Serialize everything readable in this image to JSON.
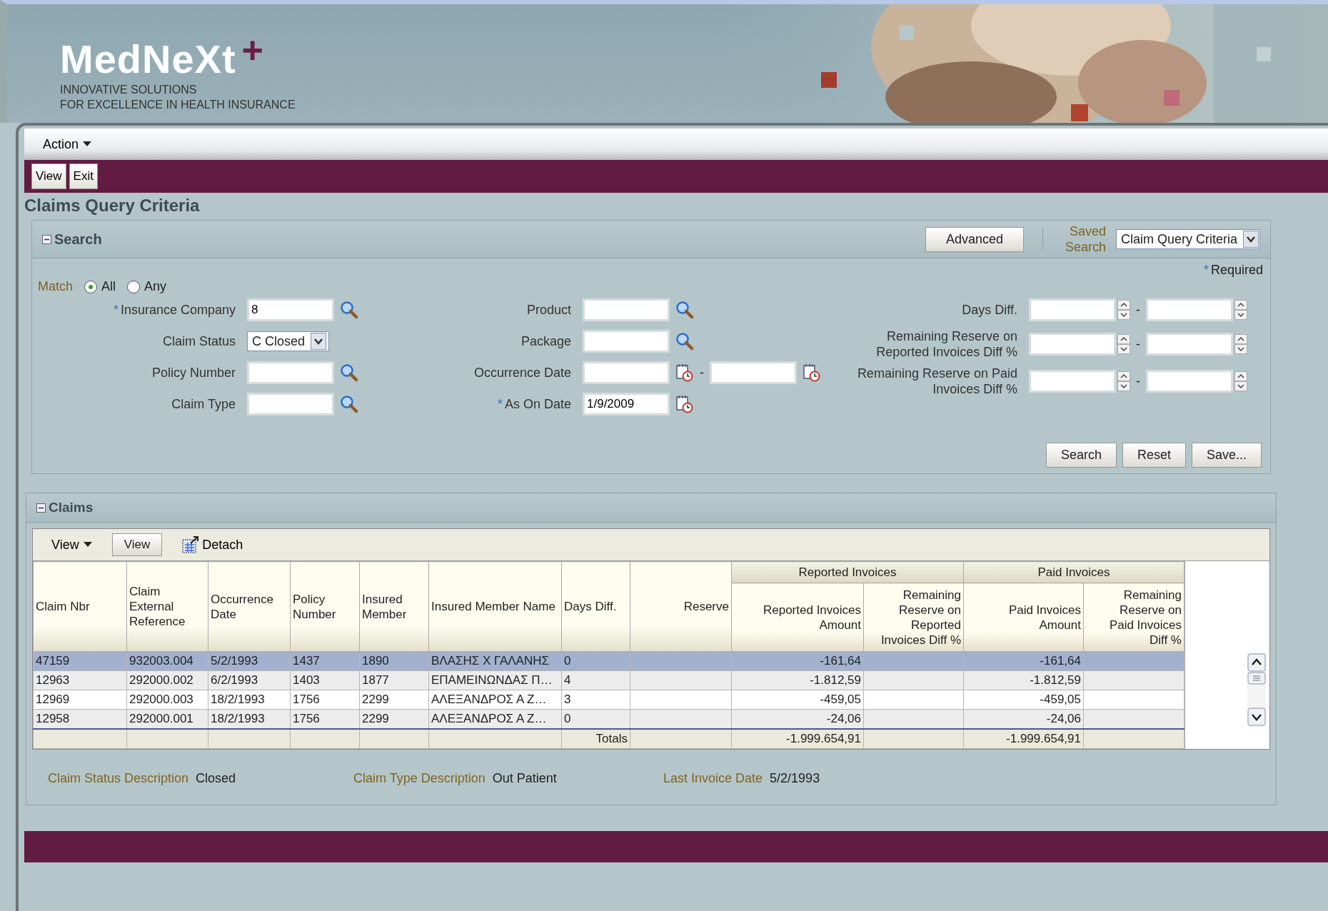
{
  "logo": {
    "name": "MedNeXt",
    "mark": "+",
    "tagline": [
      "INNOVATIVE SOLUTIONS",
      "FOR EXCELLENCE IN HEALTH INSURANCE"
    ]
  },
  "menu": {
    "label": "Action"
  },
  "toolbar": {
    "buttons": [
      "View",
      "Exit"
    ]
  },
  "page_title": "Claims Query Criteria",
  "search": {
    "title": "Search",
    "advanced": "Advanced",
    "saved_search_label": "Saved Search",
    "saved_search_value": "Claim Query Criteria",
    "required_mark": "*",
    "required_note": "Required",
    "match": {
      "label": "Match",
      "options": [
        {
          "label": "All",
          "selected": true
        },
        {
          "label": "Any",
          "selected": false
        }
      ]
    },
    "field_columns": [
      {
        "fields": [
          {
            "kind": "lookup",
            "label": "Insurance Company",
            "required": true,
            "value": "8"
          },
          {
            "kind": "select",
            "label": "Claim Status",
            "required": false,
            "value": "C Closed"
          },
          {
            "kind": "lookup",
            "label": "Policy Number",
            "required": false
          },
          {
            "kind": "lookup",
            "label": "Claim Type",
            "required": false
          }
        ]
      },
      {
        "fields": [
          {
            "kind": "lookup",
            "label": "Product",
            "required": false
          },
          {
            "kind": "lookup",
            "label": "Package",
            "required": false
          },
          {
            "kind": "date_range",
            "label": "Occurrence Date",
            "required": false,
            "separator": "-"
          },
          {
            "kind": "date",
            "label": "As On Date",
            "required": true,
            "value": "1/9/2009"
          }
        ]
      },
      {
        "fields": [
          {
            "kind": "spin_range",
            "label": "Days Diff.",
            "required": false,
            "separator": "-"
          },
          {
            "kind": "spin_range",
            "label": "Remaining Reserve on Reported Invoices Diff %",
            "required": false,
            "separator": "-"
          },
          {
            "kind": "spin_range",
            "label": "Remaining Reserve on Paid Invoices Diff %",
            "required": false,
            "separator": "-"
          }
        ]
      }
    ],
    "buttons": [
      "Search",
      "Reset",
      "Save..."
    ]
  },
  "claims": {
    "title": "Claims",
    "view_menu": "View",
    "view_button": "View",
    "detach": "Detach",
    "columns": [
      {
        "label": "Claim Nbr",
        "kind": "text"
      },
      {
        "label": "Claim External Reference",
        "kind": "text"
      },
      {
        "label": "Occurrence Date",
        "kind": "text"
      },
      {
        "label": "Policy Number",
        "kind": "text"
      },
      {
        "label": "Insured Member",
        "kind": "text"
      },
      {
        "label": "Insured Member Name",
        "kind": "text"
      },
      {
        "label": "Days Diff.",
        "kind": "text",
        "total": "Totals"
      },
      {
        "label": "Reserve",
        "kind": "number"
      },
      {
        "label": "Reported Invoices Amount",
        "kind": "number",
        "total": "-1.999.654,91",
        "group": "Reported Invoices"
      },
      {
        "label": "Remaining Reserve on Reported Invoices Diff %",
        "kind": "number",
        "in_group": true
      },
      {
        "label": "Paid Invoices Amount",
        "kind": "number",
        "total": "-1.999.654,91",
        "group": "Paid Invoices"
      },
      {
        "label": "Remaining Reserve on Paid Invoices Diff %",
        "kind": "number",
        "in_group": true
      }
    ],
    "rows": [
      {
        "selected": true,
        "cells": [
          "47159",
          "932003.004",
          "5/2/1993",
          "1437",
          "1890",
          "ΒΛΑΣΗΣ Χ ΓΑΛΑΝΗΣ",
          "0",
          null,
          "-161,64",
          null,
          "-161,64",
          null
        ]
      },
      {
        "selected": false,
        "cells": [
          "12963",
          "292000.002",
          "6/2/1993",
          "1403",
          "1877",
          "ΕΠΑΜΕΙΝΩΝΔΑΣ Π…",
          "4",
          null,
          "-1.812,59",
          null,
          "-1.812,59",
          null
        ]
      },
      {
        "selected": false,
        "cells": [
          "12969",
          "292000.003",
          "18/2/1993",
          "1756",
          "2299",
          "ΑΛΕΞΑΝΔΡΟΣ Α Ζ…",
          "3",
          null,
          "-459,05",
          null,
          "-459,05",
          null
        ]
      },
      {
        "selected": false,
        "cells": [
          "12958",
          "292000.001",
          "18/2/1993",
          "1756",
          "2299",
          "ΑΛΕΞΑΝΔΡΟΣ Α Ζ…",
          "0",
          null,
          "-24,06",
          null,
          "-24,06",
          null
        ]
      }
    ],
    "details": [
      {
        "label": "Claim Status Description",
        "value": "Closed"
      },
      {
        "label": "Claim Type Description",
        "value": "Out Patient"
      },
      {
        "label": "Last Invoice Date",
        "value": "5/2/1993"
      }
    ]
  }
}
